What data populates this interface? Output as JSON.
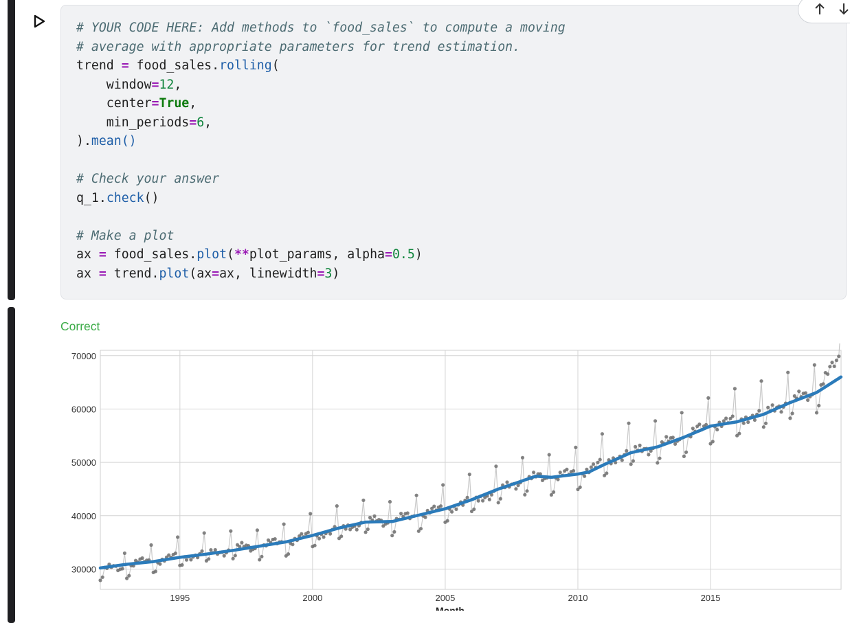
{
  "cell": {
    "code_lines": [
      [
        {
          "t": "# YOUR CODE HERE: Add methods to `food_sales` to compute a moving",
          "c": "cm"
        }
      ],
      [
        {
          "t": "# average with appropriate parameters for trend estimation.",
          "c": "cm"
        }
      ],
      [
        {
          "t": "trend "
        },
        {
          "t": "=",
          "c": "op"
        },
        {
          "t": " food_sales."
        },
        {
          "t": "rolling",
          "c": "fn"
        },
        {
          "t": "("
        }
      ],
      [
        {
          "t": "    window"
        },
        {
          "t": "=",
          "c": "op"
        },
        {
          "t": "12",
          "c": "num"
        },
        {
          "t": ","
        }
      ],
      [
        {
          "t": "    center"
        },
        {
          "t": "=",
          "c": "op"
        },
        {
          "t": "True",
          "c": "kw"
        },
        {
          "t": ","
        }
      ],
      [
        {
          "t": "    min_periods"
        },
        {
          "t": "=",
          "c": "op"
        },
        {
          "t": "6",
          "c": "num"
        },
        {
          "t": ","
        }
      ],
      [
        {
          "t": ")."
        },
        {
          "t": "mean()",
          "c": "fn"
        }
      ],
      [],
      [
        {
          "t": "# Check your answer",
          "c": "cm"
        }
      ],
      [
        {
          "t": "q_1."
        },
        {
          "t": "check",
          "c": "fn"
        },
        {
          "t": "()"
        }
      ],
      [],
      [
        {
          "t": "# Make a plot",
          "c": "cm"
        }
      ],
      [
        {
          "t": "ax "
        },
        {
          "t": "=",
          "c": "op"
        },
        {
          "t": " food_sales."
        },
        {
          "t": "plot",
          "c": "fn"
        },
        {
          "t": "("
        },
        {
          "t": "**",
          "c": "op"
        },
        {
          "t": "plot_params, alpha"
        },
        {
          "t": "=",
          "c": "op"
        },
        {
          "t": "0.5",
          "c": "num"
        },
        {
          "t": ")"
        }
      ],
      [
        {
          "t": "ax "
        },
        {
          "t": "=",
          "c": "op"
        },
        {
          "t": " trend."
        },
        {
          "t": "plot",
          "c": "fn"
        },
        {
          "t": "(ax"
        },
        {
          "t": "=",
          "c": "op"
        },
        {
          "t": "ax, linewidth"
        },
        {
          "t": "=",
          "c": "op"
        },
        {
          "t": "3",
          "c": "num"
        },
        {
          "t": ")"
        }
      ]
    ]
  },
  "toolbar": {
    "icons": [
      "move-up-icon",
      "move-down-icon",
      "delete-icon"
    ]
  },
  "output": {
    "status": "Correct"
  },
  "colors": {
    "status_green": "#3cab48",
    "trend_blue": "#2b7bba",
    "series_gray": "#6e6e6e",
    "grid": "#d4d4d4"
  },
  "chart_data": {
    "type": "line",
    "xlabel": "Month",
    "ylabel": "",
    "x_range": [
      "1992-01",
      "2019-12"
    ],
    "xlim": [
      1992.0,
      2019.92
    ],
    "ylim": [
      26200,
      71000
    ],
    "x_ticks": [
      "1995",
      "2000",
      "2005",
      "2010",
      "2015"
    ],
    "y_ticks": [
      "30000",
      "40000",
      "50000",
      "60000",
      "70000"
    ],
    "grid": true,
    "series": [
      {
        "style": "gray points joined by a faint gray line (alpha 0.5)",
        "note": "monthly values",
        "anchor_values": [
          {
            "x": "1992-01",
            "y": 29500
          },
          {
            "x": "1993-01",
            "y": 30500
          },
          {
            "x": "1994-01",
            "y": 31500
          },
          {
            "x": "1995-01",
            "y": 32200
          },
          {
            "x": "1996-01",
            "y": 32800
          },
          {
            "x": "1997-01",
            "y": 33700
          },
          {
            "x": "1998-01",
            "y": 34200
          },
          {
            "x": "1999-01",
            "y": 35000
          },
          {
            "x": "2000-01",
            "y": 36200
          },
          {
            "x": "2001-01",
            "y": 37300
          },
          {
            "x": "2002-01",
            "y": 38800
          },
          {
            "x": "2003-01",
            "y": 38900
          },
          {
            "x": "2004-01",
            "y": 40000
          },
          {
            "x": "2005-01",
            "y": 41200
          },
          {
            "x": "2006-01",
            "y": 42700
          },
          {
            "x": "2007-01",
            "y": 44500
          },
          {
            "x": "2008-01",
            "y": 46700
          },
          {
            "x": "2009-01",
            "y": 47100
          },
          {
            "x": "2010-01",
            "y": 47800
          },
          {
            "x": "2011-01",
            "y": 49800
          },
          {
            "x": "2012-01",
            "y": 51900
          },
          {
            "x": "2013-01",
            "y": 52800
          },
          {
            "x": "2014-01",
            "y": 54600
          },
          {
            "x": "2015-01",
            "y": 56800
          },
          {
            "x": "2016-01",
            "y": 57700
          },
          {
            "x": "2017-01",
            "y": 59100
          },
          {
            "x": "2018-01",
            "y": 61300
          },
          {
            "x": "2019-01",
            "y": 63000
          },
          {
            "x": "2019-12",
            "y": 70000
          }
        ]
      },
      {
        "style": "thick blue line (linewidth 3)",
        "note": "12-month centered rolling mean",
        "values": [
          {
            "x": "1992-01",
            "y": 30200
          },
          {
            "x": "1993-01",
            "y": 30900
          },
          {
            "x": "1994-01",
            "y": 31400
          },
          {
            "x": "1995-01",
            "y": 32200
          },
          {
            "x": "1996-01",
            "y": 32800
          },
          {
            "x": "1997-01",
            "y": 33500
          },
          {
            "x": "1998-01",
            "y": 34300
          },
          {
            "x": "1999-01",
            "y": 35100
          },
          {
            "x": "2000-01",
            "y": 36300
          },
          {
            "x": "2001-01",
            "y": 37700
          },
          {
            "x": "2002-01",
            "y": 38800
          },
          {
            "x": "2003-01",
            "y": 38900
          },
          {
            "x": "2004-01",
            "y": 40100
          },
          {
            "x": "2005-01",
            "y": 41300
          },
          {
            "x": "2006-01",
            "y": 43000
          },
          {
            "x": "2007-01",
            "y": 45000
          },
          {
            "x": "2008-01",
            "y": 46700
          },
          {
            "x": "2008-06",
            "y": 47400
          },
          {
            "x": "2009-01",
            "y": 47200
          },
          {
            "x": "2010-01",
            "y": 47800
          },
          {
            "x": "2010-06",
            "y": 48200
          },
          {
            "x": "2011-01",
            "y": 49600
          },
          {
            "x": "2012-01",
            "y": 51800
          },
          {
            "x": "2013-01",
            "y": 52900
          },
          {
            "x": "2014-01",
            "y": 54700
          },
          {
            "x": "2015-01",
            "y": 56800
          },
          {
            "x": "2016-01",
            "y": 57600
          },
          {
            "x": "2017-01",
            "y": 59000
          },
          {
            "x": "2018-01",
            "y": 61200
          },
          {
            "x": "2019-01",
            "y": 63100
          },
          {
            "x": "2019-12",
            "y": 66000
          }
        ]
      }
    ]
  }
}
